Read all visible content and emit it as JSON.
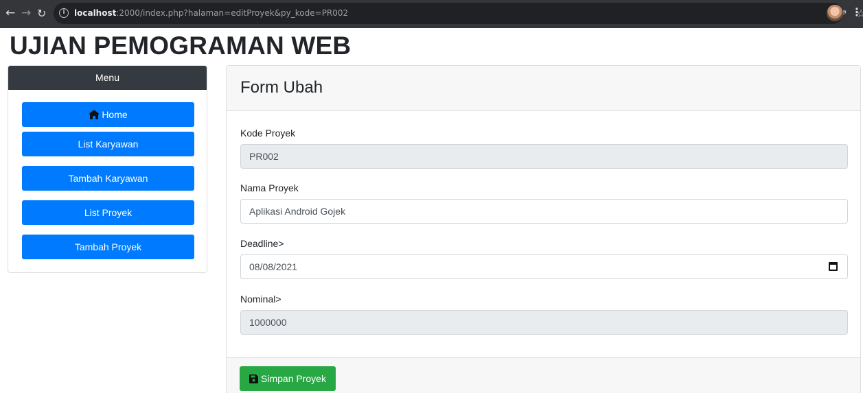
{
  "browser": {
    "url_host": "localhost",
    "url_rest": ":2000/index.php?halaman=editProyek&py_kode=PR002"
  },
  "page": {
    "title": "UJIAN PEMOGRAMAN WEB"
  },
  "sidebar": {
    "header": "Menu",
    "items": [
      {
        "label": "Home",
        "icon": "home-icon"
      },
      {
        "label": "List Karyawan"
      },
      {
        "label": "Tambah Karyawan"
      },
      {
        "label": "List Proyek"
      },
      {
        "label": "Tambah Proyek"
      }
    ]
  },
  "form": {
    "title": "Form Ubah",
    "fields": {
      "kode": {
        "label": "Kode Proyek",
        "value": "PR002",
        "readonly": true
      },
      "nama": {
        "label": "Nama Proyek",
        "value": "Aplikasi Android Gojek"
      },
      "deadline": {
        "label": "Deadline>",
        "value": "08/08/2021"
      },
      "nominal": {
        "label": "Nominal>",
        "value": "1000000",
        "readonly": true
      }
    },
    "submit_label": "Simpan Proyek"
  },
  "colors": {
    "primary": "#007bff",
    "success": "#28a745",
    "dark": "#343a40"
  }
}
